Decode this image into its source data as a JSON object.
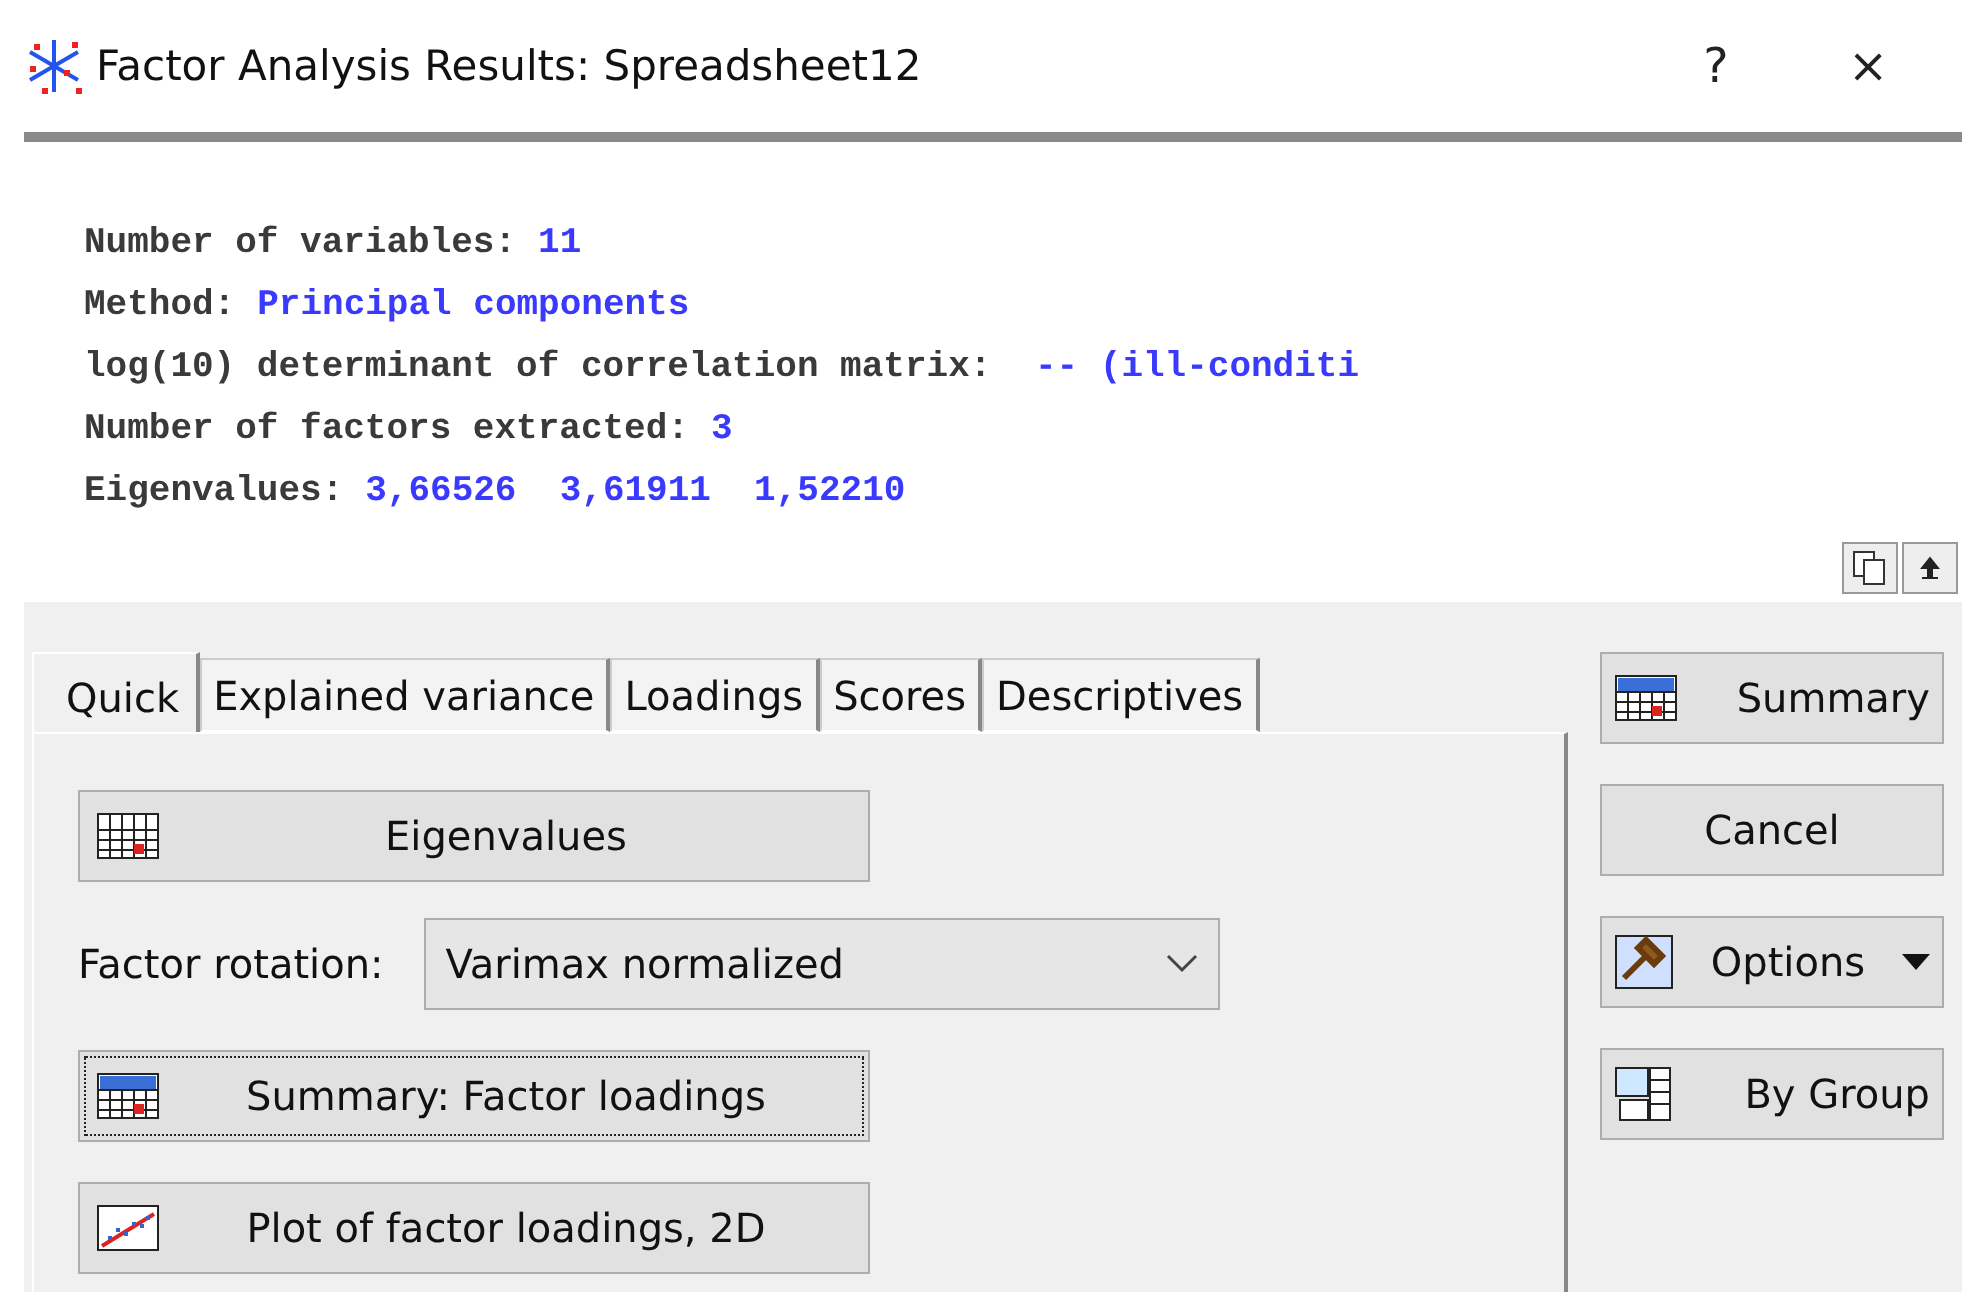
{
  "window": {
    "title": "Factor Analysis Results: Spreadsheet12",
    "help": "?",
    "close": "×"
  },
  "report": [
    {
      "label": "Number of variables:",
      "value": "11"
    },
    {
      "label": "Method:",
      "value": "Principal components"
    },
    {
      "label": "log(10) determinant of correlation matrix:",
      "value": " -- (ill-conditi"
    },
    {
      "label": "Number of factors extracted:",
      "value": "3"
    },
    {
      "label": "Eigenvalues:",
      "value": "3,66526  3,61911  1,52210"
    }
  ],
  "tabs": [
    {
      "label": "Quick",
      "selected": true
    },
    {
      "label": "Explained variance",
      "selected": false
    },
    {
      "label": "Loadings",
      "selected": false
    },
    {
      "label": "Scores",
      "selected": false
    },
    {
      "label": "Descriptives",
      "selected": false
    }
  ],
  "quick": {
    "eigenvalues_button": "Eigenvalues",
    "rotation": {
      "label": "Factor rotation:",
      "value": "Varimax normalized"
    },
    "summary_button": "Summary: Factor loadings",
    "plot_button": "Plot of factor loadings, 2D"
  },
  "side_buttons": [
    {
      "label": "Summary",
      "kind": "summary"
    },
    {
      "label": "Cancel",
      "kind": "plain"
    },
    {
      "label": "Options",
      "kind": "options"
    },
    {
      "label": "By Group",
      "kind": "bygroup"
    }
  ]
}
